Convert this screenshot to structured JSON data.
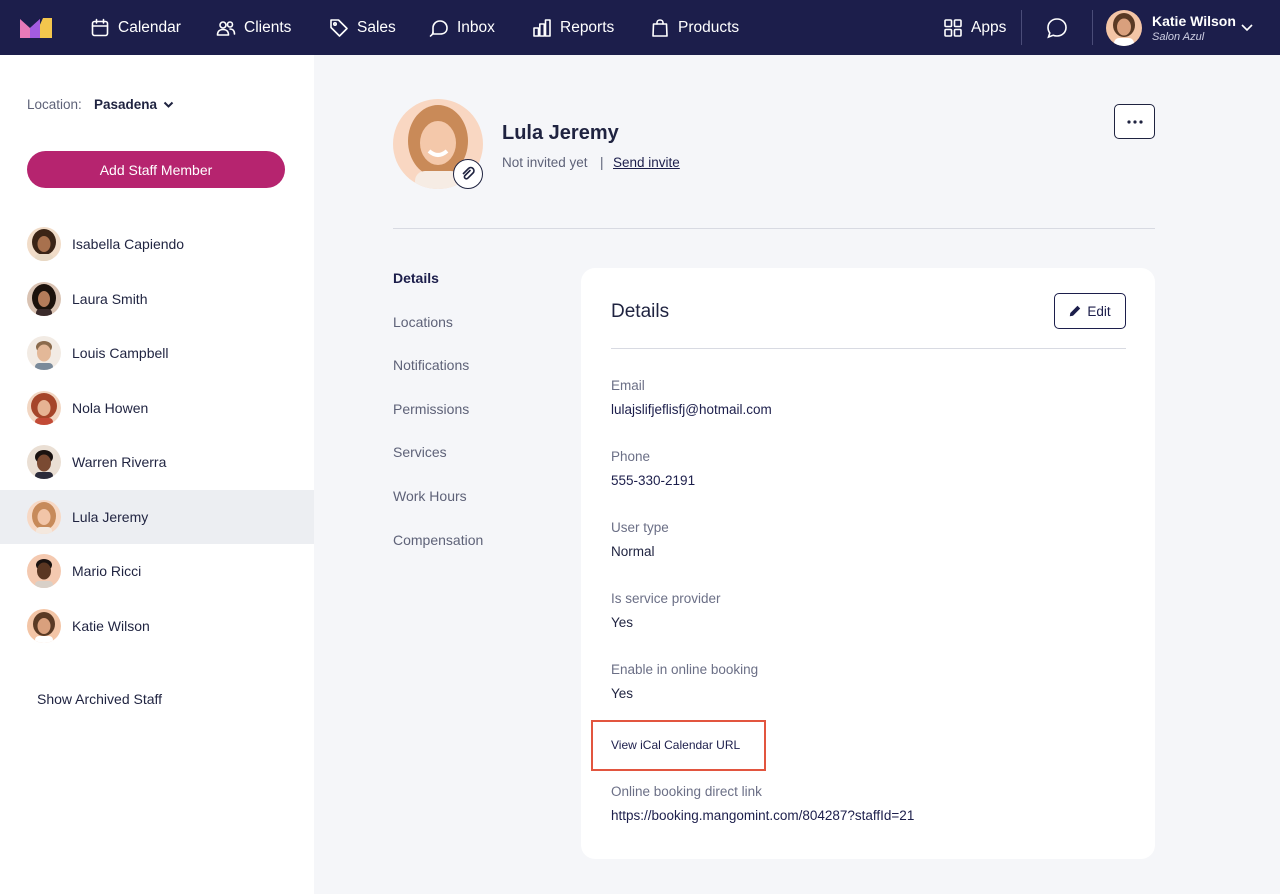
{
  "nav": {
    "items": [
      {
        "label": "Calendar",
        "icon": "calendar-icon"
      },
      {
        "label": "Clients",
        "icon": "users-icon"
      },
      {
        "label": "Sales",
        "icon": "tag-icon"
      },
      {
        "label": "Inbox",
        "icon": "inbox-chat-icon"
      },
      {
        "label": "Reports",
        "icon": "bar-chart-icon"
      },
      {
        "label": "Products",
        "icon": "shopping-bag-icon"
      }
    ],
    "apps_label": "Apps",
    "user": {
      "name": "Katie Wilson",
      "org": "Salon Azul"
    }
  },
  "sidebar": {
    "location_label": "Location:",
    "location_value": "Pasadena",
    "add_button": "Add Staff Member",
    "staff": [
      {
        "name": "Isabella Capiendo",
        "active": false
      },
      {
        "name": "Laura Smith",
        "active": false
      },
      {
        "name": "Louis Campbell",
        "active": false
      },
      {
        "name": "Nola Howen",
        "active": false
      },
      {
        "name": "Warren Riverra",
        "active": false
      },
      {
        "name": "Lula Jeremy",
        "active": true
      },
      {
        "name": "Mario Ricci",
        "active": false
      },
      {
        "name": "Katie Wilson",
        "active": false
      }
    ],
    "archived_label": "Show Archived Staff"
  },
  "profile": {
    "name": "Lula Jeremy",
    "status": "Not invited yet",
    "separator": "|",
    "invite_link": "Send invite"
  },
  "subnav": [
    {
      "label": "Details",
      "active": true
    },
    {
      "label": "Locations",
      "active": false
    },
    {
      "label": "Notifications",
      "active": false
    },
    {
      "label": "Permissions",
      "active": false
    },
    {
      "label": "Services",
      "active": false
    },
    {
      "label": "Work Hours",
      "active": false
    },
    {
      "label": "Compensation",
      "active": false
    }
  ],
  "details": {
    "title": "Details",
    "edit_label": "Edit",
    "email_label": "Email",
    "email_value": "lulajslifjeflisfj@hotmail.com",
    "phone_label": "Phone",
    "phone_value": "555-330-2191",
    "usertype_label": "User type",
    "usertype_value": "Normal",
    "provider_label": "Is service provider",
    "provider_value": "Yes",
    "online_label": "Enable in online booking",
    "online_value": "Yes",
    "ical_link": "View iCal Calendar URL",
    "booking_label": "Online booking direct link",
    "booking_value": "https://booking.mangomint.com/804287?staffId=21"
  },
  "colors": {
    "nav_bg": "#1c1e4b",
    "accent": "#b6246f",
    "highlight": "#e2553f"
  }
}
